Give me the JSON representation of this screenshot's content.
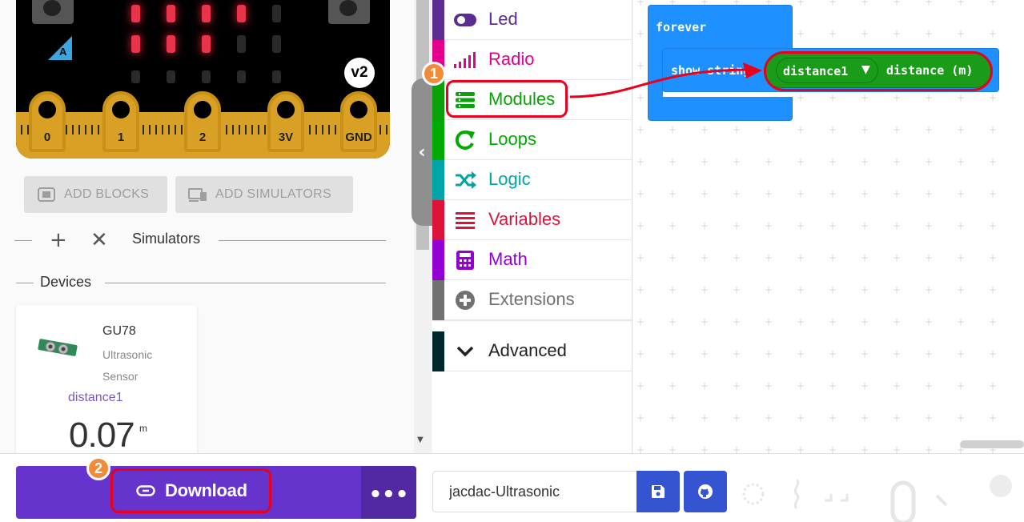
{
  "simulator": {
    "board_version": "v2",
    "button_a_label": "A",
    "pins": [
      "0",
      "1",
      "2",
      "3V",
      "GND"
    ],
    "led_matrix": [
      [
        1,
        1,
        1,
        1,
        0
      ],
      [
        1,
        1,
        1,
        0,
        0
      ],
      [
        0,
        0,
        0,
        0,
        0
      ]
    ]
  },
  "left_panel": {
    "add_blocks_label": "ADD BLOCKS",
    "add_simulators_label": "ADD SIMULATORS",
    "simulators_heading": "Simulators",
    "devices_heading": "Devices",
    "device": {
      "name": "GU78",
      "description": "Ultrasonic Sensor",
      "role": "distance1",
      "value": "0.07",
      "unit": "m"
    }
  },
  "toolbox": {
    "categories": [
      {
        "label": "Led",
        "color": "#5c2d91",
        "icon": "toggle-icon"
      },
      {
        "label": "Radio",
        "color": "#e3008c",
        "icon": "signal-icon"
      },
      {
        "label": "Modules",
        "color": "#0aa10a",
        "icon": "modules-icon"
      },
      {
        "label": "Loops",
        "color": "#00aa00",
        "icon": "loop-icon"
      },
      {
        "label": "Logic",
        "color": "#00a4a6",
        "icon": "shuffle-icon"
      },
      {
        "label": "Variables",
        "color": "#dc143c",
        "icon": "list-icon"
      },
      {
        "label": "Math",
        "color": "#9400d3",
        "icon": "calculator-icon"
      },
      {
        "label": "Extensions",
        "color": "#717171",
        "icon": "plus-circle-icon"
      },
      {
        "label": "Advanced",
        "color": "#00272b",
        "icon": "chevron-down-icon"
      }
    ]
  },
  "workspace": {
    "forever_label": "forever",
    "show_string_label": "show string",
    "variable_dropdown": "distance1",
    "distance_label": "distance (m)"
  },
  "footer": {
    "download_label": "Download",
    "more_label": "•••",
    "project_name": "jacdac-Ultrasonic"
  },
  "annotations": {
    "badge_1": "1",
    "badge_2": "2",
    "annotation_color": "#e8001c",
    "badge_color": "#f08b3a"
  }
}
